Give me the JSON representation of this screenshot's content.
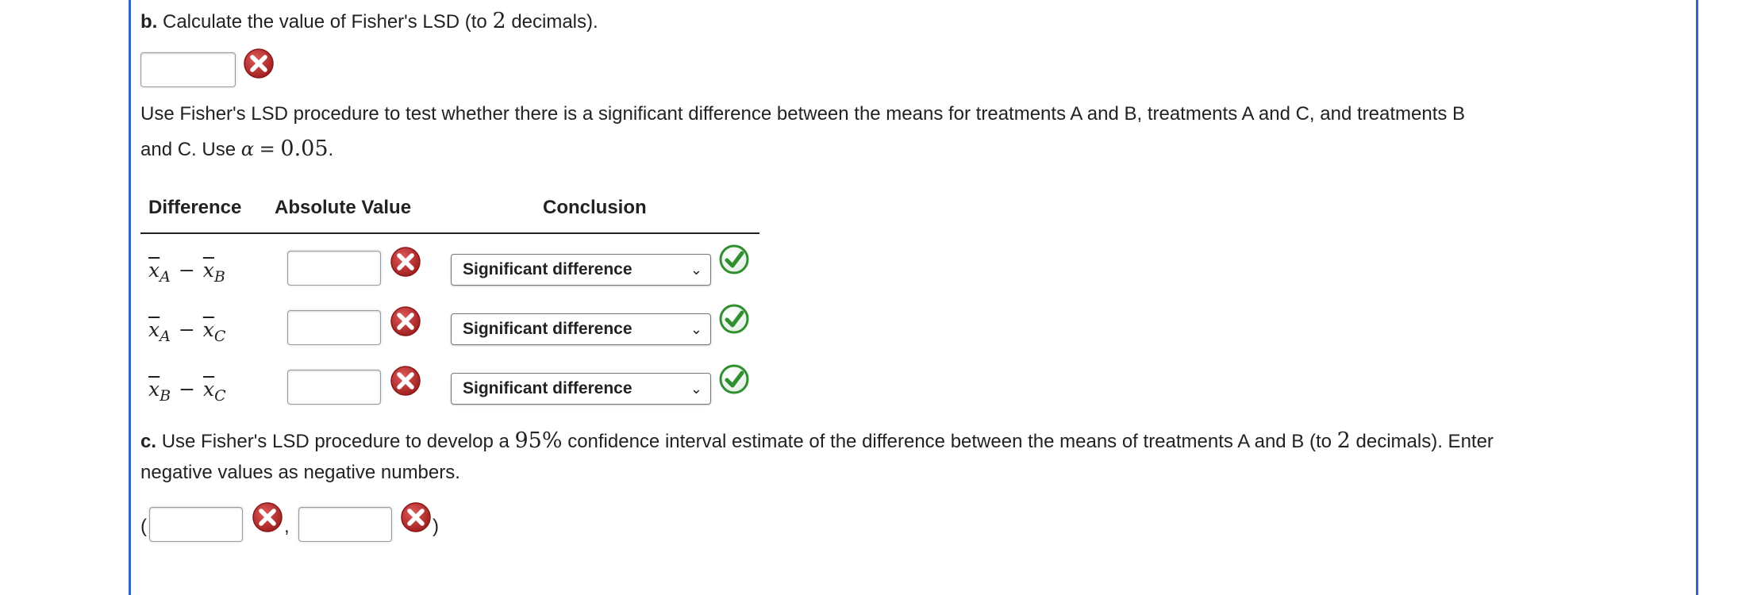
{
  "part_b": {
    "prefix": "b.",
    "text": "Calculate the value of Fisher's LSD (to",
    "decimals": "2",
    "suffix": "decimals)."
  },
  "procedure": {
    "line1": "Use Fisher's LSD procedure to test whether there is a significant difference between the means for treatments A and B, treatments A and C, and treatments B",
    "line2_prefix": "and C. Use",
    "alpha_symbol": "α",
    "equals": "=",
    "alpha_value": "0.05",
    "period": "."
  },
  "table": {
    "headers": {
      "difference": "Difference",
      "absolute_value": "Absolute Value",
      "conclusion": "Conclusion"
    },
    "rows": [
      {
        "left_sub": "A",
        "right_sub": "B",
        "value": "",
        "conclusion": "Significant difference"
      },
      {
        "left_sub": "A",
        "right_sub": "C",
        "value": "",
        "conclusion": "Significant difference"
      },
      {
        "left_sub": "B",
        "right_sub": "C",
        "value": "",
        "conclusion": "Significant difference"
      }
    ],
    "var": "x",
    "minus": "−"
  },
  "part_c": {
    "prefix": "c.",
    "text1": "Use Fisher's LSD procedure to develop a",
    "percent": "95%",
    "text2": "confidence interval estimate of the difference between the means of treatments A and B (to",
    "decimals": "2",
    "text3": "decimals). Enter",
    "line2": "negative values as negative numbers.",
    "open_paren": "(",
    "comma": ",",
    "close_paren": ")"
  },
  "icons": {
    "incorrect": "incorrect-x-icon",
    "correct": "correct-check-icon"
  },
  "colors": {
    "frame": "#2f66c4",
    "incorrect": "#b52a2a",
    "correct": "#2f8f2f"
  }
}
